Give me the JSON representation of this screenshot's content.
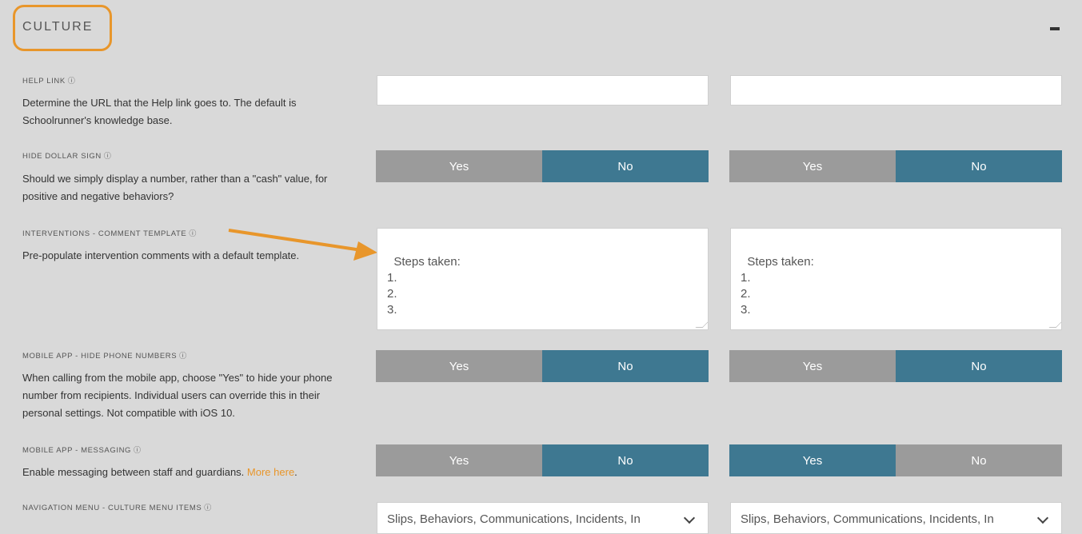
{
  "section": {
    "title": "CULTURE",
    "collapse_icon": "minus-icon"
  },
  "rows": {
    "help_link": {
      "label": "HELP LINK",
      "info": "ⓘ",
      "description": "Determine the URL that the Help link goes to. The default is Schoolrunner's knowledge base.",
      "values": [
        "",
        ""
      ]
    },
    "hide_dollar": {
      "label": "HIDE DOLLAR SIGN",
      "info": "ⓘ",
      "description": "Should we simply display a number, rather than a \"cash\" value, for positive and negative behaviors?",
      "yes": "Yes",
      "no": "No",
      "selected": [
        "No",
        "No"
      ]
    },
    "interventions": {
      "label": "INTERVENTIONS - COMMENT TEMPLATE",
      "info": "ⓘ",
      "description": "Pre-populate intervention comments with a default template.",
      "values": [
        "Steps taken:\n1.\n2.\n3.",
        "Steps taken:\n1.\n2.\n3."
      ]
    },
    "mobile_hide_phone": {
      "label": "MOBILE APP - HIDE PHONE NUMBERS",
      "info": "ⓘ",
      "description": "When calling from the mobile app, choose \"Yes\" to hide your phone number from recipients. Individual users can override this in their personal settings. Not compatible with iOS 10.",
      "yes": "Yes",
      "no": "No",
      "selected": [
        "No",
        "No"
      ]
    },
    "mobile_messaging": {
      "label": "MOBILE APP - MESSAGING",
      "info": "ⓘ",
      "description": "Enable messaging between staff and guardians.",
      "link_text": "More here",
      "link_suffix": ".",
      "yes": "Yes",
      "no": "No",
      "selected": [
        "No",
        "Yes"
      ]
    },
    "nav_menu": {
      "label": "NAVIGATION MENU - CULTURE MENU ITEMS",
      "info": "ⓘ",
      "values": [
        "Slips, Behaviors, Communications, Incidents, In",
        "Slips, Behaviors, Communications, Incidents, In"
      ]
    }
  },
  "colors": {
    "accent": "#e8962b",
    "selected": "#3e7891",
    "unselected": "#9b9b9b",
    "background": "#d9d9d9"
  }
}
